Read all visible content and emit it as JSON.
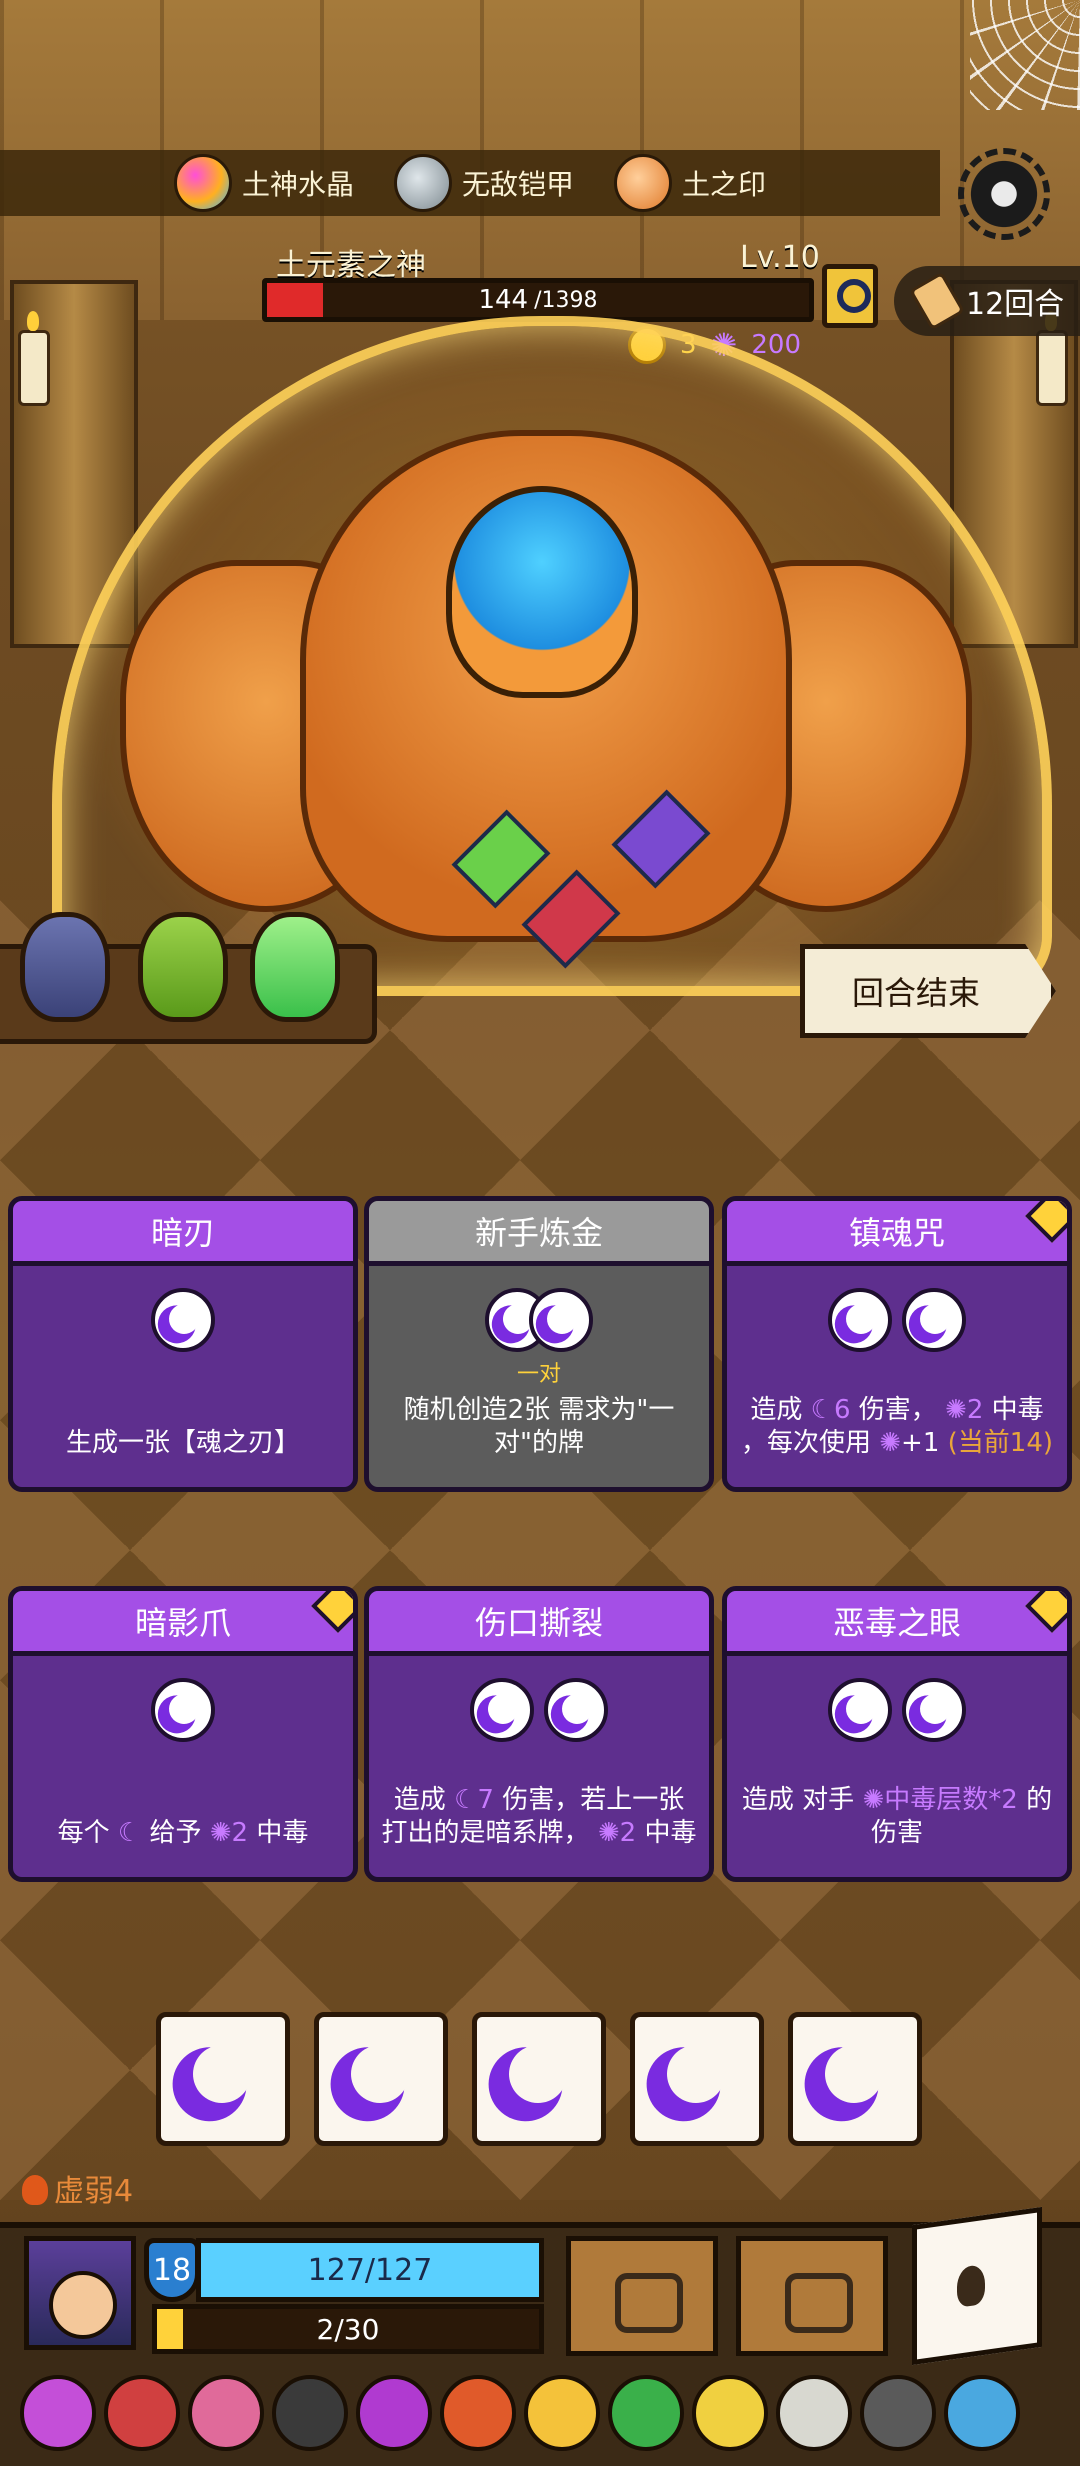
{
  "relics_top": [
    {
      "label": "土神水晶",
      "icon": "earth-crystal-icon"
    },
    {
      "label": "无敌铠甲",
      "icon": "armor-icon"
    },
    {
      "label": "土之印",
      "icon": "earth-seal-icon"
    }
  ],
  "boss": {
    "name": "土元素之神",
    "level": "Lv.10",
    "hp_current": "144",
    "hp_max": "/1398",
    "hp_fraction": 0.103
  },
  "turn": {
    "label": "12回合"
  },
  "drops": {
    "gold": "3",
    "soul": "200"
  },
  "end_turn_label": "回合结束",
  "cards": [
    {
      "title": "暗刃",
      "desc": "生成一张【魂之刃】",
      "slots": 1,
      "style": "purple"
    },
    {
      "title": "新手炼金",
      "pair": "一对",
      "desc": "随机创造2张 需求为\"一对\"的牌",
      "slots": 2,
      "style": "gray"
    },
    {
      "title": "镇魂咒",
      "desc_a": "造成",
      "desc_b": "6",
      "desc_c": "伤害，",
      "desc_d": "2",
      "desc_e": "中毒",
      "desc_f": "，每次使用",
      "desc_g": "+1",
      "desc_h": "(当前14)",
      "slots": 2,
      "style": "purple"
    },
    {
      "title": "暗影爪",
      "desc_a": "每个",
      "desc_b": "给予",
      "desc_c": "2",
      "desc_d": "中毒",
      "slots": 1,
      "style": "purple"
    },
    {
      "title": "伤口撕裂",
      "desc_a": "造成",
      "desc_b": "7",
      "desc_c": "伤害，若上一张打出的是暗系牌，",
      "desc_d": "2",
      "desc_e": "中毒",
      "slots": 2,
      "style": "purple"
    },
    {
      "title": "恶毒之眼",
      "desc_a": "造成 对手",
      "desc_b": "中毒层数*2",
      "desc_c": "的伤害",
      "slots": 2,
      "style": "purple"
    }
  ],
  "dice_count": 5,
  "status": {
    "weak": "虚弱4"
  },
  "player": {
    "shield": "18",
    "hp": "127/127",
    "xp": "2/30",
    "xp_fraction": 0.067
  },
  "colors": {
    "card_purple": "#5e2f8e",
    "card_header": "#a44fe6",
    "poison_accent": "#c77aff",
    "gold": "#ffd23a",
    "hp_blue": "#5ad0ff"
  },
  "trinkets": [
    "splash-icon",
    "rune-stone-icon",
    "heart-icon",
    "bracelet-icon",
    "poison-apple-icon",
    "ring-icon",
    "eye-orb-icon",
    "turtle-shell-icon",
    "lantern-icon",
    "scroll-icon",
    "stone-icon",
    "blue-ring-icon"
  ]
}
